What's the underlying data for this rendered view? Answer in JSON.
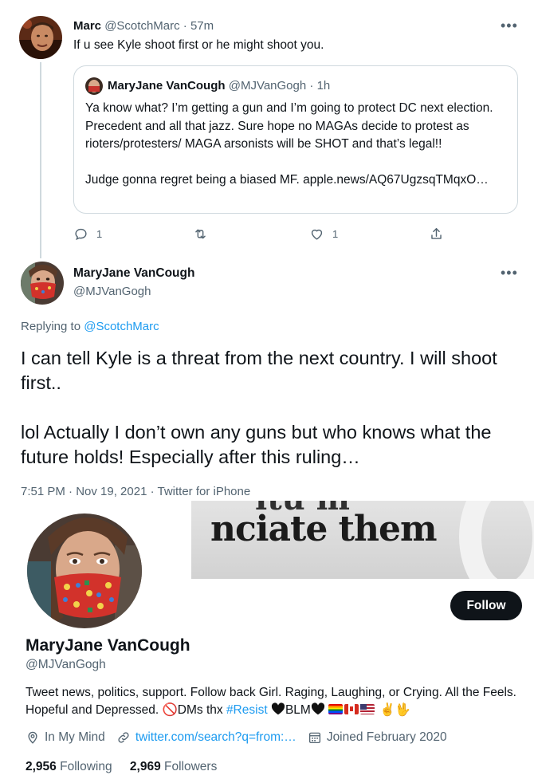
{
  "parent_tweet": {
    "display_name": "Marc",
    "handle": "@ScotchMarc",
    "separator": "·",
    "time": "57m",
    "more": "•••",
    "text": "If u see Kyle shoot first or he might shoot you.",
    "quoted": {
      "display_name": "MaryJane VanCough",
      "handle": "@MJVanGogh",
      "separator": "·",
      "time": "1h",
      "text": "Ya know what? I’m getting a gun and I’m going to protect DC next election. Precedent and all that jazz. Sure hope no MAGAs decide to protest as rioters/protesters/ MAGA arsonists will be SHOT and that’s legal!!\n\nJudge gonna regret being a biased MF. apple.news/AQ67UgzsqTMqxO…"
    },
    "actions": {
      "reply_count": "1",
      "retweet_count": "",
      "like_count": "1"
    }
  },
  "main_tweet": {
    "display_name": "MaryJane VanCough",
    "handle": "@MJVanGogh",
    "more": "•••",
    "replying_prefix": "Replying to",
    "replying_to": "@ScotchMarc",
    "text": "I can tell Kyle is a threat from the next country. I will shoot first..\n\nlol Actually I don’t own any guns but who knows what the future holds! Especially after this ruling…",
    "timestamp": "7:51 PM · Nov 19, 2021 · Twitter for iPhone"
  },
  "profile": {
    "banner_text": "nciate them",
    "banner_text_top": "itu m",
    "follow_label": "Follow",
    "display_name": "MaryJane VanCough",
    "handle": "@MJVanGogh",
    "bio_part1": "Tweet news, politics, support. Follow back Girl. Raging, Laughing, or Crying. All the Feels. Hopeful and Depressed. ",
    "bio_no_symbol": "🚫",
    "bio_part2": "DMs thx ",
    "bio_hashtag": "#Resist",
    "bio_blm": "BLM",
    "bio_hands": "✌️🖖",
    "location": "In My Mind",
    "website": "twitter.com/search?q=from:…",
    "joined": "Joined February 2020",
    "following_count": "2,956",
    "following_label": "Following",
    "followers_count": "2,969",
    "followers_label": "Followers"
  },
  "colors": {
    "accent": "#1d9bf0",
    "text_primary": "#0f1419",
    "text_secondary": "#536471",
    "border": "#cfd9de",
    "follow_button_bg": "#0f1419"
  }
}
